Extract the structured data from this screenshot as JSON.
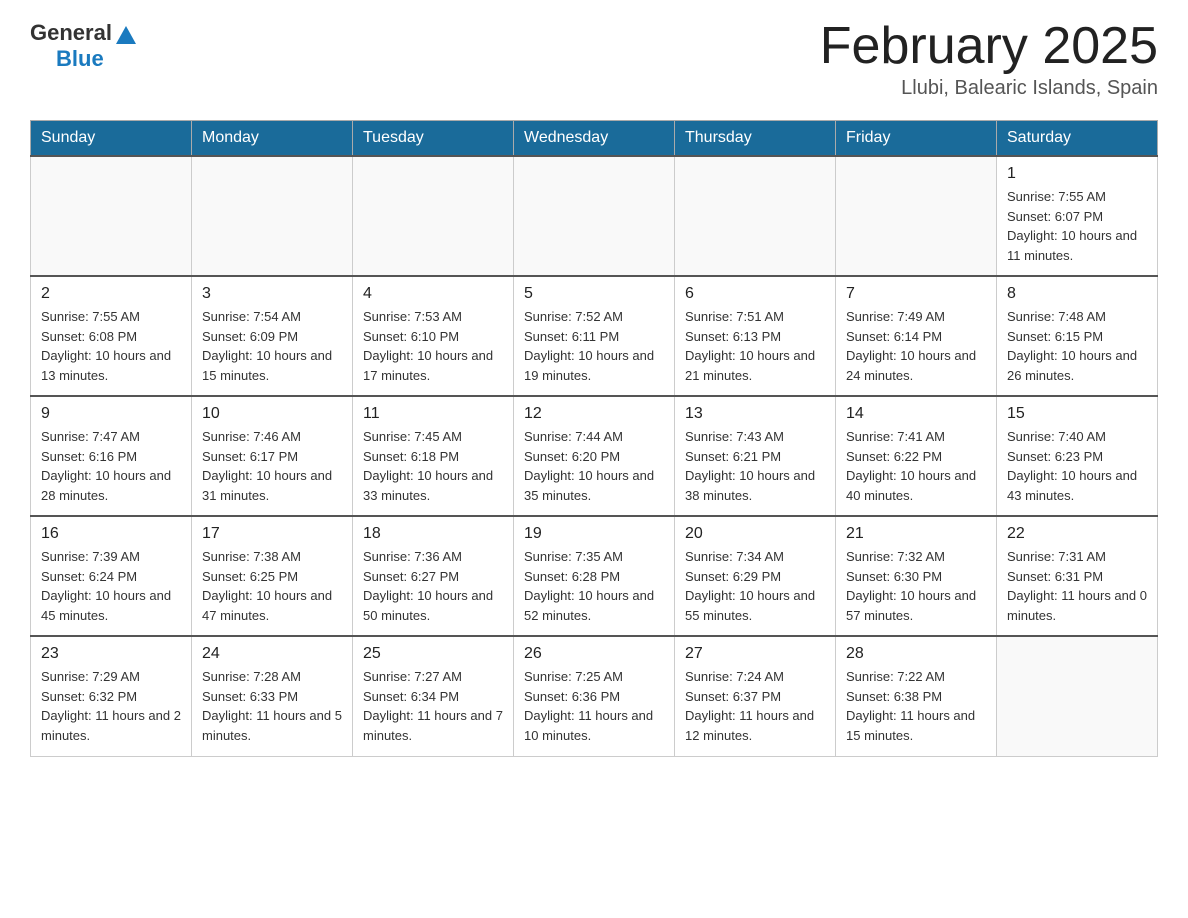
{
  "header": {
    "logo_general": "General",
    "logo_blue": "Blue",
    "month_title": "February 2025",
    "location": "Llubi, Balearic Islands, Spain"
  },
  "days_of_week": [
    "Sunday",
    "Monday",
    "Tuesday",
    "Wednesday",
    "Thursday",
    "Friday",
    "Saturday"
  ],
  "weeks": [
    {
      "days": [
        {
          "number": "",
          "info": "",
          "empty": true
        },
        {
          "number": "",
          "info": "",
          "empty": true
        },
        {
          "number": "",
          "info": "",
          "empty": true
        },
        {
          "number": "",
          "info": "",
          "empty": true
        },
        {
          "number": "",
          "info": "",
          "empty": true
        },
        {
          "number": "",
          "info": "",
          "empty": true
        },
        {
          "number": "1",
          "info": "Sunrise: 7:55 AM\nSunset: 6:07 PM\nDaylight: 10 hours and 11 minutes.",
          "empty": false
        }
      ]
    },
    {
      "days": [
        {
          "number": "2",
          "info": "Sunrise: 7:55 AM\nSunset: 6:08 PM\nDaylight: 10 hours and 13 minutes.",
          "empty": false
        },
        {
          "number": "3",
          "info": "Sunrise: 7:54 AM\nSunset: 6:09 PM\nDaylight: 10 hours and 15 minutes.",
          "empty": false
        },
        {
          "number": "4",
          "info": "Sunrise: 7:53 AM\nSunset: 6:10 PM\nDaylight: 10 hours and 17 minutes.",
          "empty": false
        },
        {
          "number": "5",
          "info": "Sunrise: 7:52 AM\nSunset: 6:11 PM\nDaylight: 10 hours and 19 minutes.",
          "empty": false
        },
        {
          "number": "6",
          "info": "Sunrise: 7:51 AM\nSunset: 6:13 PM\nDaylight: 10 hours and 21 minutes.",
          "empty": false
        },
        {
          "number": "7",
          "info": "Sunrise: 7:49 AM\nSunset: 6:14 PM\nDaylight: 10 hours and 24 minutes.",
          "empty": false
        },
        {
          "number": "8",
          "info": "Sunrise: 7:48 AM\nSunset: 6:15 PM\nDaylight: 10 hours and 26 minutes.",
          "empty": false
        }
      ]
    },
    {
      "days": [
        {
          "number": "9",
          "info": "Sunrise: 7:47 AM\nSunset: 6:16 PM\nDaylight: 10 hours and 28 minutes.",
          "empty": false
        },
        {
          "number": "10",
          "info": "Sunrise: 7:46 AM\nSunset: 6:17 PM\nDaylight: 10 hours and 31 minutes.",
          "empty": false
        },
        {
          "number": "11",
          "info": "Sunrise: 7:45 AM\nSunset: 6:18 PM\nDaylight: 10 hours and 33 minutes.",
          "empty": false
        },
        {
          "number": "12",
          "info": "Sunrise: 7:44 AM\nSunset: 6:20 PM\nDaylight: 10 hours and 35 minutes.",
          "empty": false
        },
        {
          "number": "13",
          "info": "Sunrise: 7:43 AM\nSunset: 6:21 PM\nDaylight: 10 hours and 38 minutes.",
          "empty": false
        },
        {
          "number": "14",
          "info": "Sunrise: 7:41 AM\nSunset: 6:22 PM\nDaylight: 10 hours and 40 minutes.",
          "empty": false
        },
        {
          "number": "15",
          "info": "Sunrise: 7:40 AM\nSunset: 6:23 PM\nDaylight: 10 hours and 43 minutes.",
          "empty": false
        }
      ]
    },
    {
      "days": [
        {
          "number": "16",
          "info": "Sunrise: 7:39 AM\nSunset: 6:24 PM\nDaylight: 10 hours and 45 minutes.",
          "empty": false
        },
        {
          "number": "17",
          "info": "Sunrise: 7:38 AM\nSunset: 6:25 PM\nDaylight: 10 hours and 47 minutes.",
          "empty": false
        },
        {
          "number": "18",
          "info": "Sunrise: 7:36 AM\nSunset: 6:27 PM\nDaylight: 10 hours and 50 minutes.",
          "empty": false
        },
        {
          "number": "19",
          "info": "Sunrise: 7:35 AM\nSunset: 6:28 PM\nDaylight: 10 hours and 52 minutes.",
          "empty": false
        },
        {
          "number": "20",
          "info": "Sunrise: 7:34 AM\nSunset: 6:29 PM\nDaylight: 10 hours and 55 minutes.",
          "empty": false
        },
        {
          "number": "21",
          "info": "Sunrise: 7:32 AM\nSunset: 6:30 PM\nDaylight: 10 hours and 57 minutes.",
          "empty": false
        },
        {
          "number": "22",
          "info": "Sunrise: 7:31 AM\nSunset: 6:31 PM\nDaylight: 11 hours and 0 minutes.",
          "empty": false
        }
      ]
    },
    {
      "days": [
        {
          "number": "23",
          "info": "Sunrise: 7:29 AM\nSunset: 6:32 PM\nDaylight: 11 hours and 2 minutes.",
          "empty": false
        },
        {
          "number": "24",
          "info": "Sunrise: 7:28 AM\nSunset: 6:33 PM\nDaylight: 11 hours and 5 minutes.",
          "empty": false
        },
        {
          "number": "25",
          "info": "Sunrise: 7:27 AM\nSunset: 6:34 PM\nDaylight: 11 hours and 7 minutes.",
          "empty": false
        },
        {
          "number": "26",
          "info": "Sunrise: 7:25 AM\nSunset: 6:36 PM\nDaylight: 11 hours and 10 minutes.",
          "empty": false
        },
        {
          "number": "27",
          "info": "Sunrise: 7:24 AM\nSunset: 6:37 PM\nDaylight: 11 hours and 12 minutes.",
          "empty": false
        },
        {
          "number": "28",
          "info": "Sunrise: 7:22 AM\nSunset: 6:38 PM\nDaylight: 11 hours and 15 minutes.",
          "empty": false
        },
        {
          "number": "",
          "info": "",
          "empty": true
        }
      ]
    }
  ]
}
